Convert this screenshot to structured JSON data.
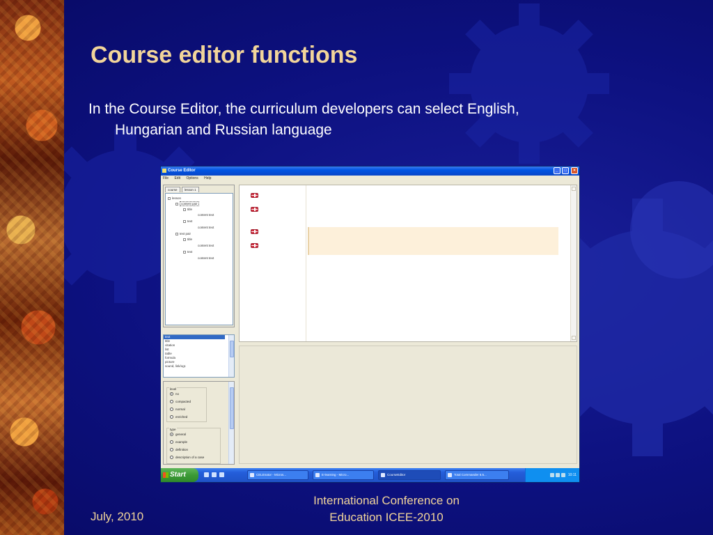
{
  "slide": {
    "title": "Course editor functions",
    "body_line1": "In the Course Editor, the curriculum developers can select English,",
    "body_line2": "Hungarian and Russian language",
    "footer_left": "July, 2010",
    "footer_center_line1": "International Conference on",
    "footer_center_line2": "Education ICEE-2010",
    "colors": {
      "title": "#f2d59a",
      "background": "#0c0f7c",
      "text": "#ffffff"
    }
  },
  "screenshot": {
    "window_title": "Course Editor",
    "menu": [
      "File",
      "Edit",
      "Options",
      "Help"
    ],
    "tabs": [
      "course",
      "lesson 1"
    ],
    "tree": {
      "root": "lesson",
      "n1": "content pair",
      "n1a": "title",
      "n1a_t": "content text",
      "n1b": "text",
      "n1b_t": "content text",
      "n2": "text pair",
      "n2a": "title",
      "n2a_t": "content text",
      "n2b": "text",
      "n2b_t": "content text"
    },
    "list_items": [
      "text",
      "title",
      "citation",
      "list",
      "table",
      "formula",
      "picture",
      "sound, link/ogr."
    ],
    "level_group": {
      "title": "level",
      "options": [
        "no",
        "compacted",
        "normal",
        "enriched"
      ],
      "selected": "no"
    },
    "type_group": {
      "title": "type",
      "options": [
        "general",
        "example",
        "definition",
        "description of a case"
      ],
      "selected": "general"
    },
    "taskbar": {
      "start": "Start",
      "tasks": [
        "CELEnator - Micros...",
        "E-learning - Micro...",
        "CourseEditor",
        "Total Commander 6.5..."
      ],
      "tray_time": "10:11"
    },
    "flag_icon": "uk-flag-icon"
  }
}
